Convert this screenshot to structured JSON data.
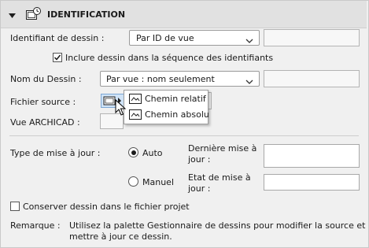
{
  "section": {
    "title": "IDENTIFICATION",
    "icon": "drawing-identification-icon",
    "expanded": true
  },
  "identifiant": {
    "label": "Identifiant de dessin :",
    "value": "Par ID de vue",
    "field_value": ""
  },
  "include_checkbox": {
    "label": "Inclure dessin dans la séquence des identifiants",
    "checked": true
  },
  "nom": {
    "label": "Nom du Dessin :",
    "value": "Par vue : nom seulement",
    "field_value": ""
  },
  "source": {
    "label": "Fichier source :",
    "button_icon": "source-file-icon",
    "field_value": ""
  },
  "archicad": {
    "label": "Vue ARCHICAD :",
    "field_value": ""
  },
  "popup_menu": {
    "items": [
      {
        "label": "Chemin relatif",
        "icon": "relative-path-icon"
      },
      {
        "label": "Chemin absolu",
        "icon": "absolute-path-icon"
      }
    ]
  },
  "update": {
    "label": "Type de mise à jour :",
    "auto_label": "Auto",
    "manual_label": "Manuel",
    "selected": "Auto",
    "last_label_1": "Dernière mise à",
    "last_label_2": "jour :",
    "state_label_1": "Etat de mise à",
    "state_label_2": "jour :",
    "last_value": "",
    "state_value": ""
  },
  "keep_checkbox": {
    "label": "Conserver dessin dans le fichier projet",
    "checked": false
  },
  "remark": {
    "label": "Remarque :",
    "line1": "Utilisez la palette Gestionnaire de dessins pour modifier la source et",
    "line2": "mettre à jour ce dessin."
  },
  "colors": {
    "header_bg": "#e1e1e1",
    "panel_bg": "#f0f0f0",
    "accent": "#1a1a1a"
  }
}
